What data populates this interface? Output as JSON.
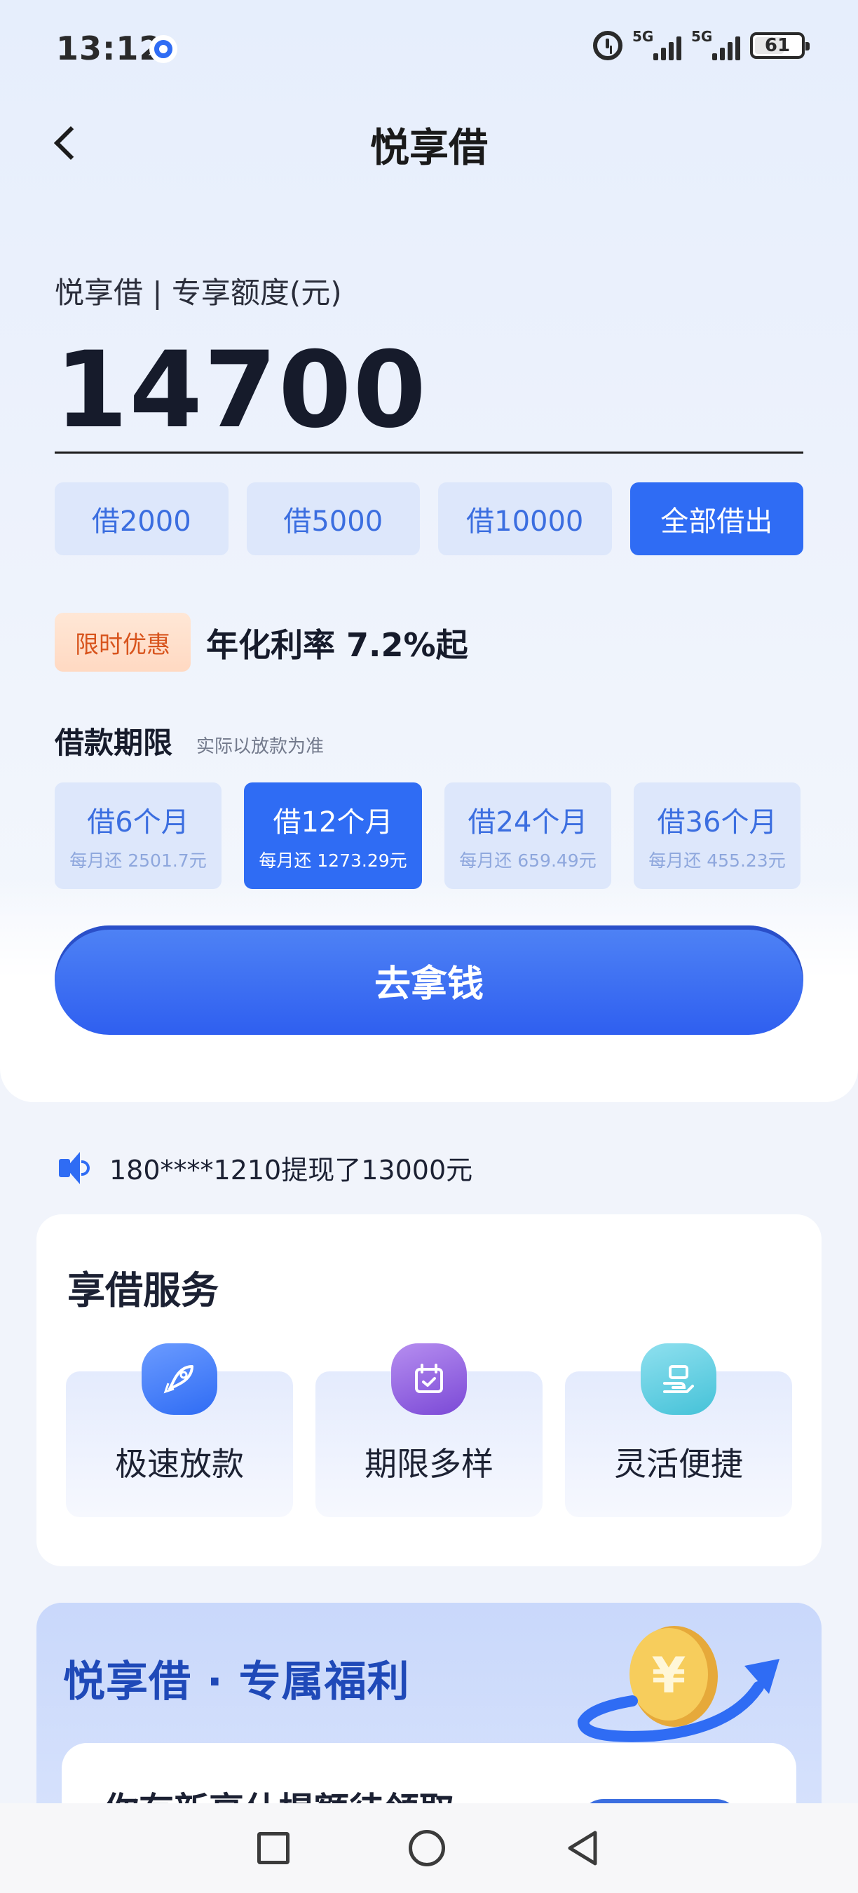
{
  "status_bar": {
    "time": "13:12",
    "signal1": "5G",
    "signal2": "5G",
    "battery": "61"
  },
  "header": {
    "title": "悦享借"
  },
  "quota": {
    "label": "悦享借 | 专享额度(元)",
    "amount": "14700"
  },
  "quick_amounts": [
    {
      "label": "借2000"
    },
    {
      "label": "借5000"
    },
    {
      "label": "借10000"
    },
    {
      "label": "全部借出",
      "selected": true
    }
  ],
  "promo": {
    "badge": "限时优惠",
    "text": "年化利率 7.2%起"
  },
  "term": {
    "title": "借款期限",
    "note": "实际以放款为准",
    "options": [
      {
        "label": "借6个月",
        "monthly": "每月还 2501.7元"
      },
      {
        "label": "借12个月",
        "monthly": "每月还 1273.29元",
        "selected": true
      },
      {
        "label": "借24个月",
        "monthly": "每月还 659.49元"
      },
      {
        "label": "借36个月",
        "monthly": "每月还 455.23元"
      }
    ]
  },
  "cta": {
    "label": "去拿钱"
  },
  "notice": {
    "text": "180****1210提现了13000元"
  },
  "services": {
    "title": "享借服务",
    "items": [
      {
        "label": "极速放款",
        "icon": "rocket-icon"
      },
      {
        "label": "期限多样",
        "icon": "calendar-check-icon"
      },
      {
        "label": "灵活便捷",
        "icon": "hand-card-icon"
      }
    ]
  },
  "benefits": {
    "title": "悦享借 · 专属福利",
    "peek_text": "你有新享什提额待领取"
  },
  "colors": {
    "primary": "#2f6cf4",
    "chip_bg": "#dde7fb",
    "promo_orange": "#d8541d",
    "benefit_title": "#1f49b8"
  }
}
